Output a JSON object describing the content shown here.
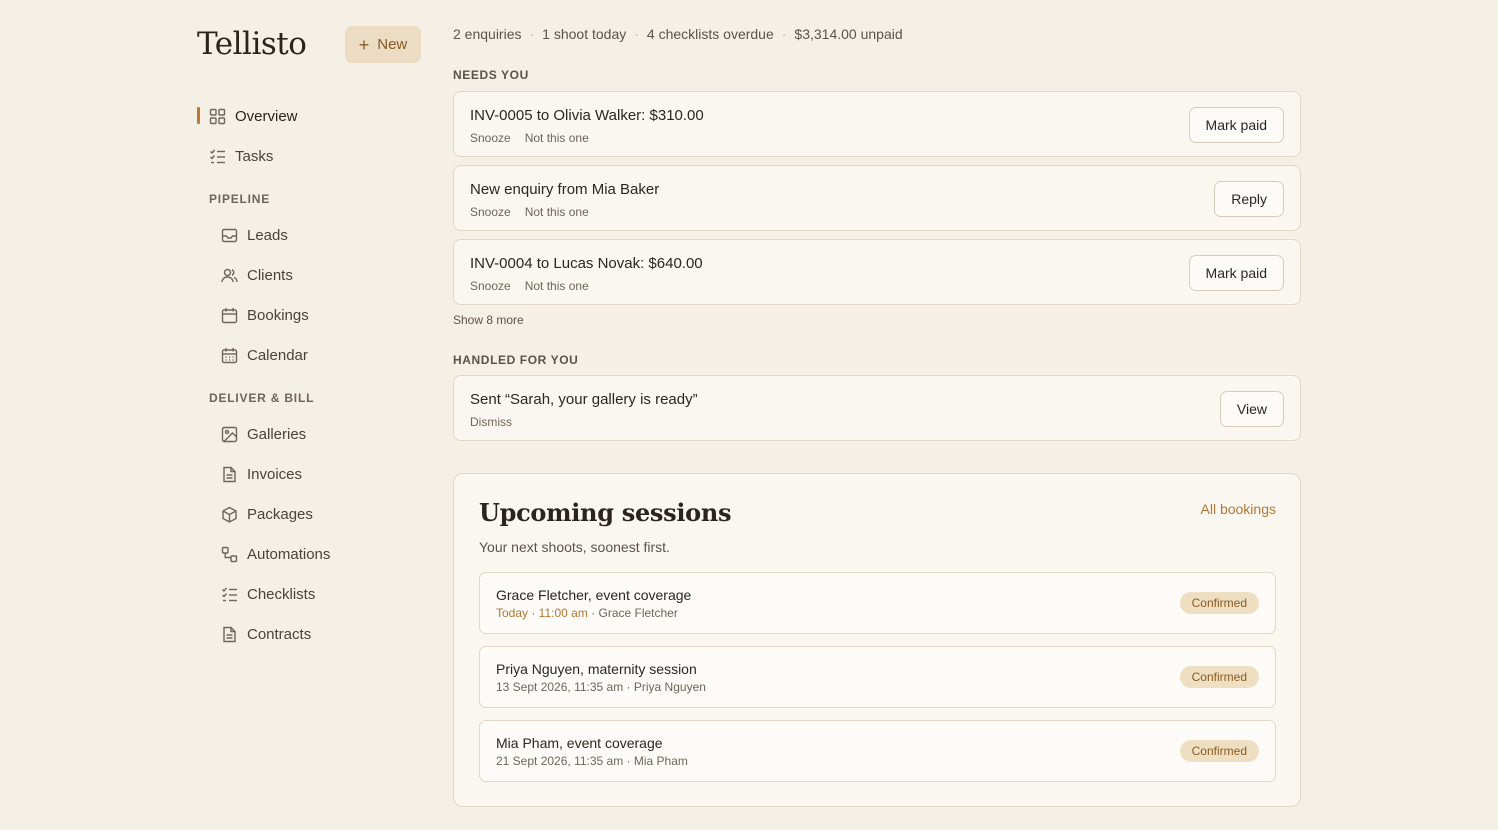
{
  "app": {
    "name": "Tellisto",
    "new_label": "New"
  },
  "sidebar": {
    "items_top": [
      {
        "label": "Overview",
        "icon": "grid-icon"
      },
      {
        "label": "Tasks",
        "icon": "list-check-icon"
      }
    ],
    "pipeline_label": "PIPELINE",
    "pipeline": [
      {
        "label": "Leads",
        "icon": "inbox-icon"
      },
      {
        "label": "Clients",
        "icon": "users-icon"
      },
      {
        "label": "Bookings",
        "icon": "calendar-icon"
      },
      {
        "label": "Calendar",
        "icon": "calendar-grid-icon"
      }
    ],
    "deliver_label": "DELIVER & BILL",
    "deliver": [
      {
        "label": "Galleries",
        "icon": "image-icon"
      },
      {
        "label": "Invoices",
        "icon": "document-icon"
      },
      {
        "label": "Packages",
        "icon": "box-icon"
      },
      {
        "label": "Automations",
        "icon": "workflow-icon"
      },
      {
        "label": "Checklists",
        "icon": "list-check-icon"
      },
      {
        "label": "Contracts",
        "icon": "document-icon"
      }
    ]
  },
  "stats": {
    "enquiries": "2 enquiries",
    "shoots": "1 shoot today",
    "checklists": "4 checklists overdue",
    "unpaid": "$3,314.00 unpaid"
  },
  "needs_you": {
    "label": "NEEDS YOU",
    "cards": [
      {
        "title": "INV-0005 to Olivia Walker: $310.00",
        "snooze": "Snooze",
        "dismiss": "Not this one",
        "action": "Mark paid"
      },
      {
        "title": "New enquiry from Mia Baker",
        "snooze": "Snooze",
        "dismiss": "Not this one",
        "action": "Reply"
      },
      {
        "title": "INV-0004 to Lucas Novak: $640.00",
        "snooze": "Snooze",
        "dismiss": "Not this one",
        "action": "Mark paid"
      }
    ],
    "show_more": "Show 8 more"
  },
  "handled": {
    "label": "HANDLED FOR YOU",
    "card": {
      "title": "Sent “Sarah, your gallery is ready”",
      "dismiss": "Dismiss",
      "action": "View"
    }
  },
  "upcoming": {
    "title": "Upcoming sessions",
    "subtitle": "Your next shoots, soonest first.",
    "link": "All bookings",
    "sessions": [
      {
        "title": "Grace Fletcher, event coverage",
        "date": "Today · 11:00 am",
        "client": " · Grace Fletcher",
        "status": "Confirmed"
      },
      {
        "title": "Priya Nguyen, maternity session",
        "date": "13 Sept 2026, 11:35 am",
        "client": " · Priya Nguyen",
        "status": "Confirmed"
      },
      {
        "title": "Mia Pham, event coverage",
        "date": "21 Sept 2026, 11:35 am",
        "client": " · Mia Pham",
        "status": "Confirmed"
      }
    ]
  }
}
